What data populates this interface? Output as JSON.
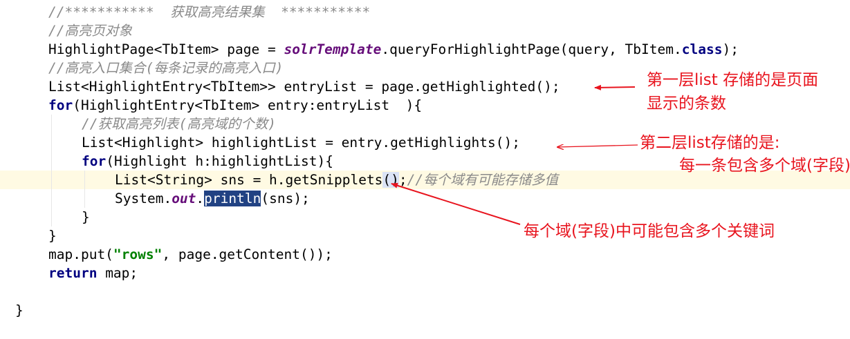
{
  "editor": {
    "lines": [
      {
        "indent": 1,
        "tokens": [
          {
            "t": "//***********  获取高亮结果集  ***********",
            "k": "comment"
          }
        ]
      },
      {
        "indent": 1,
        "tokens": [
          {
            "t": "//高亮页对象",
            "k": "comment"
          }
        ]
      },
      {
        "indent": 1,
        "tokens": [
          {
            "t": "HighlightPage<TbItem> page = ",
            "k": "plain"
          },
          {
            "t": "solrTemplate",
            "k": "field"
          },
          {
            "t": ".queryForHighlightPage(query, TbItem.",
            "k": "plain"
          },
          {
            "t": "class",
            "k": "keyword"
          },
          {
            "t": ");",
            "k": "plain"
          }
        ]
      },
      {
        "indent": 1,
        "tokens": [
          {
            "t": "//高亮入口集合(每条记录的高亮入口)",
            "k": "comment"
          }
        ]
      },
      {
        "indent": 1,
        "tokens": [
          {
            "t": "List<HighlightEntry<TbItem>> entryList = page.getHighlighted();",
            "k": "plain"
          }
        ]
      },
      {
        "indent": 1,
        "tokens": [
          {
            "t": "for",
            "k": "keyword"
          },
          {
            "t": "(HighlightEntry<TbItem> entry:entryList  ){",
            "k": "plain"
          }
        ]
      },
      {
        "indent": 2,
        "tokens": [
          {
            "t": "//获取高亮列表(高亮域的个数)",
            "k": "comment"
          }
        ]
      },
      {
        "indent": 2,
        "tokens": [
          {
            "t": "List<Highlight> highlightList = entry.getHighlights();",
            "k": "plain"
          }
        ]
      },
      {
        "indent": 2,
        "tokens": [
          {
            "t": "for",
            "k": "keyword"
          },
          {
            "t": "(Highlight h:highlightList){",
            "k": "plain"
          }
        ]
      },
      {
        "indent": 3,
        "tokens": [
          {
            "t": "List<String> sns = h.getSnipplets",
            "k": "plain"
          },
          {
            "t": "()",
            "k": "hl"
          },
          {
            "t": ";",
            "k": "plain"
          },
          {
            "t": "//每个域有可能存储多值",
            "k": "comment"
          }
        ],
        "current": true
      },
      {
        "indent": 3,
        "tokens": [
          {
            "t": "System.",
            "k": "plain"
          },
          {
            "t": "out",
            "k": "static"
          },
          {
            "t": ".",
            "k": "plain"
          },
          {
            "t": "println",
            "k": "selected"
          },
          {
            "t": "(sns);",
            "k": "plain"
          }
        ]
      },
      {
        "indent": 2,
        "tokens": [
          {
            "t": "}",
            "k": "plain"
          }
        ]
      },
      {
        "indent": 1,
        "tokens": [
          {
            "t": "}",
            "k": "plain"
          }
        ]
      },
      {
        "indent": 1,
        "tokens": [
          {
            "t": "map.put(",
            "k": "plain"
          },
          {
            "t": "\"rows\"",
            "k": "string"
          },
          {
            "t": ", page.getContent());",
            "k": "plain"
          }
        ]
      },
      {
        "indent": 1,
        "tokens": [
          {
            "t": "return",
            "k": "keyword"
          },
          {
            "t": " map;",
            "k": "plain"
          }
        ]
      },
      {
        "indent": 1,
        "tokens": []
      },
      {
        "indent": 0,
        "tokens": [
          {
            "t": "}",
            "k": "plain"
          }
        ]
      }
    ]
  },
  "annotations": {
    "first_layer_line1": "第一层list 存储的是页面",
    "first_layer_line2": "显示的条数",
    "second_layer_line1": "第二层list存储的是:",
    "second_layer_line2": "每一条包含多个域(字段)",
    "field_keywords": "每个域(字段)中可能包含多个关键词"
  },
  "colors": {
    "comment": "#8a8a8a",
    "keyword": "#000080",
    "field": "#660e7a",
    "string": "#008000",
    "selection": "#214283",
    "current_line": "#fffae3",
    "annotation": "#e8141e"
  }
}
